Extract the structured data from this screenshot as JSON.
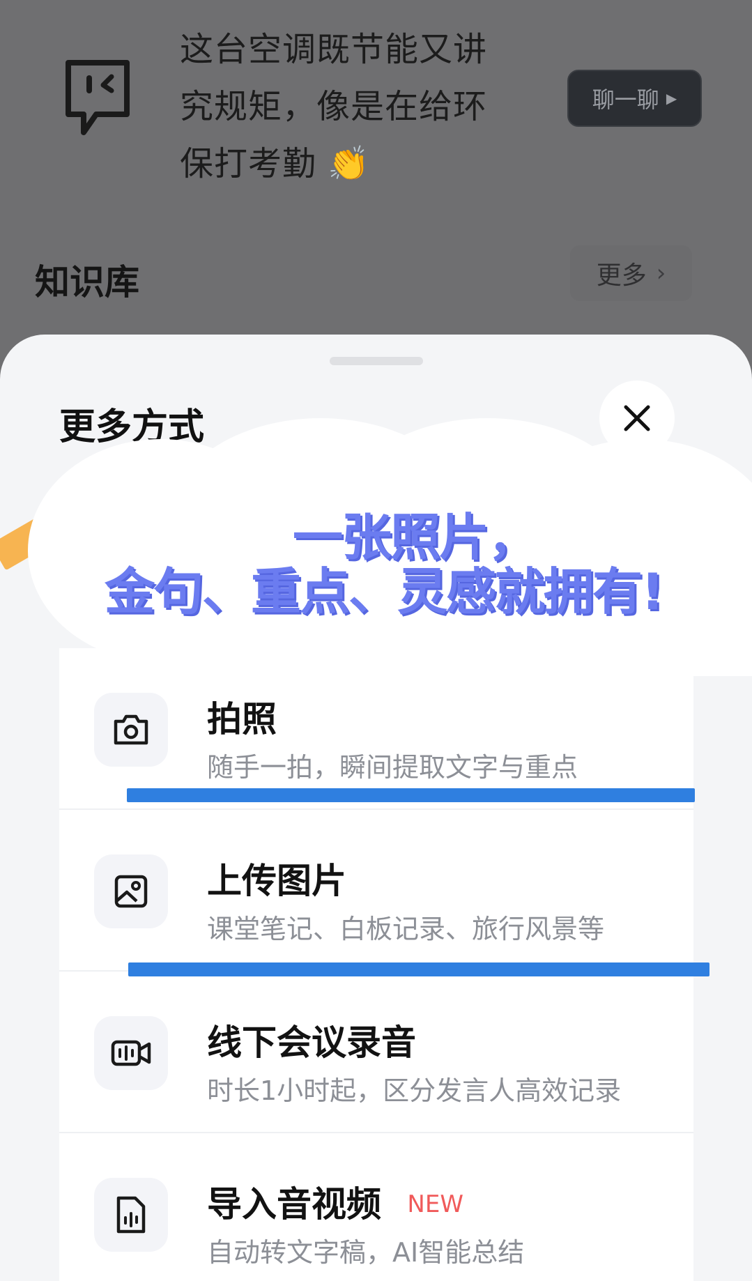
{
  "background": {
    "bubble_line1": "这台空调既节能又讲",
    "bubble_line2": "究规矩，像是在给环",
    "bubble_line3": "保打考勤",
    "clap_emoji": "👏",
    "chat_button_label": "聊一聊",
    "knowledge_title": "知识库",
    "more_label": "更多"
  },
  "sheet": {
    "title": "更多方式",
    "close_icon": "close-icon"
  },
  "overlay": {
    "line1": "一张照片，",
    "line2": "金句、重点、灵感就拥有!"
  },
  "options": [
    {
      "title": "拍照",
      "subtitle": "随手一拍，瞬间提取文字与重点",
      "icon": "camera-icon"
    },
    {
      "title": "上传图片",
      "subtitle": "课堂笔记、白板记录、旅行风景等",
      "icon": "image-icon"
    },
    {
      "title": "线下会议录音",
      "subtitle": "时长1小时起，区分发言人高效记录",
      "icon": "record-icon"
    },
    {
      "title": "导入音视频",
      "badge": "NEW",
      "subtitle": "自动转文字稿，AI智能总结",
      "icon": "audio-file-icon"
    }
  ],
  "colors": {
    "overlay_text": "#6b7cf0",
    "underline": "#2f7fe0",
    "new_badge": "#f05a5a",
    "dim_background": "#6f6f71"
  }
}
